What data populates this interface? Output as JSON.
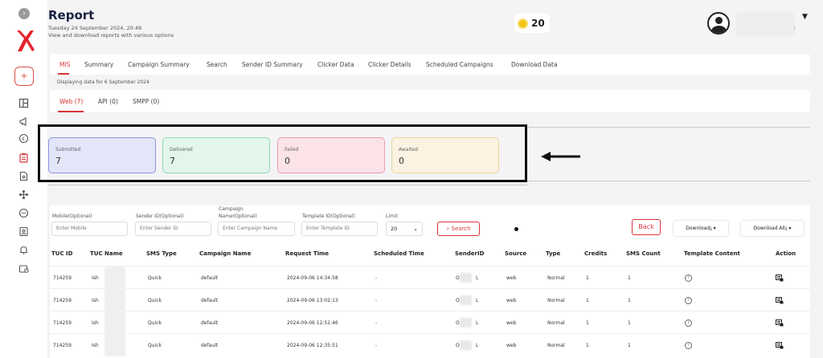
{
  "page": {
    "title": "Report",
    "date": "Tuesday 24 September 2024, 20:48",
    "subtitle": "View and download reports with various options"
  },
  "header": {
    "coins": "20",
    "user_suffix": ")"
  },
  "sidebar": {
    "collapse_icon": "chevron-right-icon",
    "add_label": "+",
    "icons": [
      "dashboard-icon",
      "megaphone-icon",
      "currency-icon",
      "report-icon",
      "document-icon",
      "network-icon",
      "api-icon",
      "contacts-icon",
      "bell-icon",
      "wallet-icon"
    ]
  },
  "tabs": [
    "MIS",
    "Summary",
    "Campaign Summary",
    "Search",
    "Sender ID Summary",
    "Clicker Data",
    "Clicker Details",
    "Scheduled Campaigns",
    "Download Data"
  ],
  "display_info": "Displaying data for 6 September 2024",
  "subtabs": [
    "Web (7)",
    "API (0)",
    "SMPP (0)"
  ],
  "stats": [
    {
      "label": "Submitted",
      "value": "7",
      "bg": "#e3e5f8",
      "border": "#8f96e0"
    },
    {
      "label": "Delivered",
      "value": "7",
      "bg": "#e2f6ec",
      "border": "#8fd9b1"
    },
    {
      "label": "Failed",
      "value": "0",
      "bg": "#fbe3e8",
      "border": "#ec9ab0"
    },
    {
      "label": "Awaited",
      "value": "0",
      "bg": "#fbf2e1",
      "border": "#ecd595"
    }
  ],
  "filters": {
    "mobile_label": "Mobile(Optional)",
    "mobile_placeholder": "Enter Mobile",
    "sender_label": "Sender ID(Optional)",
    "sender_placeholder": "Enter Sender ID",
    "campaign_label_1": "Campaign",
    "campaign_label_2": "Name(Optional)",
    "campaign_placeholder": "Enter Campaign Name",
    "template_label": "Template ID(Optional)",
    "template_placeholder": "Enter Template ID",
    "limit_label": "Limit",
    "limit_value": "20",
    "search_label": "Search",
    "back_label": "Back",
    "download_label": "Download",
    "download_all_label": "Download All"
  },
  "table": {
    "columns": [
      "TUC ID",
      "TUC Name",
      "SMS Type",
      "Campaign Name",
      "Request Time",
      "Scheduled Time",
      "SenderID",
      "Source",
      "Type",
      "Credits",
      "SMS Count",
      "Template Content",
      "Action"
    ],
    "rows": [
      {
        "tuc_id": "714259",
        "tuc_name": "Ish",
        "sms_type": "Quick",
        "campaign": "default",
        "request_time": "2024-09-06 14:34:58",
        "scheduled": "-",
        "sender_prefix": "O",
        "sender_suffix": "L",
        "source": "web",
        "type": "Normal",
        "credits": "1",
        "sms_count": "1"
      },
      {
        "tuc_id": "714259",
        "tuc_name": "Ish",
        "sms_type": "Quick",
        "campaign": "default",
        "request_time": "2024-09-06 13:02:13",
        "scheduled": "-",
        "sender_prefix": "O",
        "sender_suffix": "L",
        "source": "web",
        "type": "Normal",
        "credits": "1",
        "sms_count": "1"
      },
      {
        "tuc_id": "714259",
        "tuc_name": "Ish",
        "sms_type": "Quick",
        "campaign": "default",
        "request_time": "2024-09-06 12:52:46",
        "scheduled": "-",
        "sender_prefix": "O",
        "sender_suffix": "L",
        "source": "web",
        "type": "Normal",
        "credits": "1",
        "sms_count": "1"
      },
      {
        "tuc_id": "714259",
        "tuc_name": "Ish",
        "sms_type": "Quick",
        "campaign": "default",
        "request_time": "2024-09-06 12:35:51",
        "scheduled": "-",
        "sender_prefix": "O",
        "sender_suffix": "L",
        "source": "web",
        "type": "Normal",
        "credits": "1",
        "sms_count": "1"
      }
    ]
  }
}
